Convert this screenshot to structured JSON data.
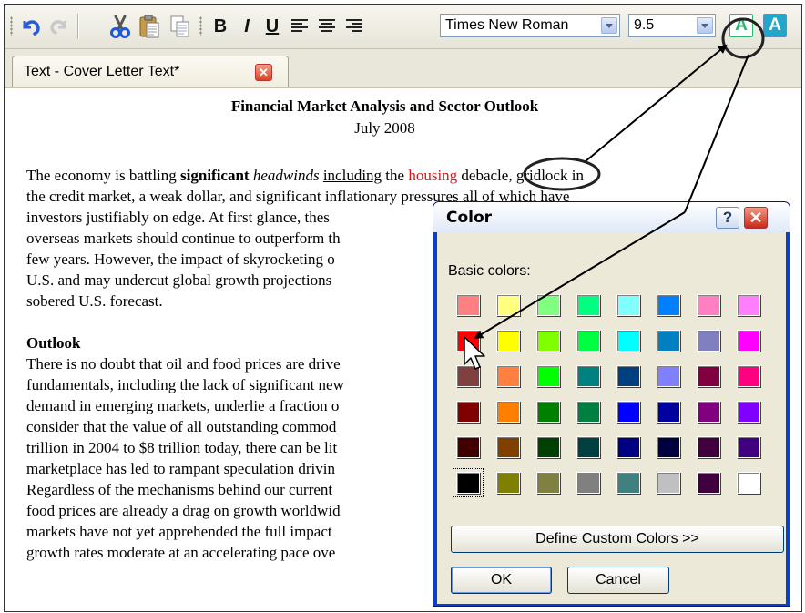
{
  "toolbar": {
    "buttons": [
      "undo-icon",
      "redo-icon",
      "cut-icon",
      "paste-icon",
      "copy-icon"
    ],
    "bold_label": "B",
    "italic_label": "I",
    "underline_label": "U",
    "font_name": "Times New Roman",
    "font_size": "9.5",
    "font_color_glyph": "A",
    "highlight_glyph": "A",
    "colors": {
      "font_color_active": "#2bb673",
      "highlight": "#23a7c9"
    }
  },
  "tab": {
    "label": "Text - Cover Letter Text*",
    "close_glyph": "✕"
  },
  "document": {
    "title": "Financial Market Analysis and Sector Outlook",
    "date": "July 2008",
    "paragraph1": {
      "l1_a": "The economy is battling ",
      "l1_bold": "significant",
      "l1_b": " ",
      "l1_italic": "headwinds",
      "l1_c": " ",
      "l1_underline": "including",
      "l1_d": " the ",
      "l1_housing": "housing",
      "l1_e": " debacle, gridlock in",
      "l2": "the credit market, a weak dollar, and significant inflationary pressures all of which have",
      "l3": "investors justifiably on edge.  At first glance, thes",
      "l4": "overseas markets should continue to outperform th",
      "l5": "few years.  However, the impact of skyrocketing o",
      "l6": "U.S. and may undercut global growth projections",
      "l7": "sobered U.S. forecast."
    },
    "heading": "Outlook",
    "paragraph2": [
      "There is no doubt that oil and food prices are drive",
      "fundamentals, including the lack of significant new",
      "demand in emerging markets, underlie a fraction o",
      "consider that the value of all outstanding commod",
      "trillion in 2004 to $8 trillion today, there can be lit",
      "marketplace has led to rampant speculation drivin",
      "Regardless of the mechanisms behind our current",
      "food prices are already a drag on growth worldwid",
      "markets have not yet apprehended the full impact",
      "growth rates moderate at an accelerating pace ove"
    ]
  },
  "color_dialog": {
    "title": "Color",
    "help_glyph": "?",
    "close_glyph": "✕",
    "basic_colors_label": "Basic colors:",
    "basic_colors": [
      [
        "#ff8080",
        "#ffff80",
        "#80ff80",
        "#00ff80",
        "#80ffff",
        "#0080ff",
        "#ff80c0",
        "#ff80ff"
      ],
      [
        "#ff0000",
        "#ffff00",
        "#80ff00",
        "#00ff40",
        "#00ffff",
        "#0080c0",
        "#8080c0",
        "#ff00ff"
      ],
      [
        "#804040",
        "#ff8040",
        "#00ff00",
        "#008080",
        "#004080",
        "#8080ff",
        "#800040",
        "#ff0080"
      ],
      [
        "#800000",
        "#ff8000",
        "#008000",
        "#008040",
        "#0000ff",
        "#0000a0",
        "#800080",
        "#8000ff"
      ],
      [
        "#400000",
        "#804000",
        "#004000",
        "#004040",
        "#000080",
        "#000040",
        "#400040",
        "#400080"
      ],
      [
        "#000000",
        "#808000",
        "#808040",
        "#808080",
        "#408080",
        "#c0c0c0",
        "#400040",
        "#ffffff"
      ]
    ],
    "selected_swatch": "row 6, column 1",
    "define_custom_label": "Define Custom Colors >>",
    "ok_label": "OK",
    "cancel_label": "Cancel"
  }
}
